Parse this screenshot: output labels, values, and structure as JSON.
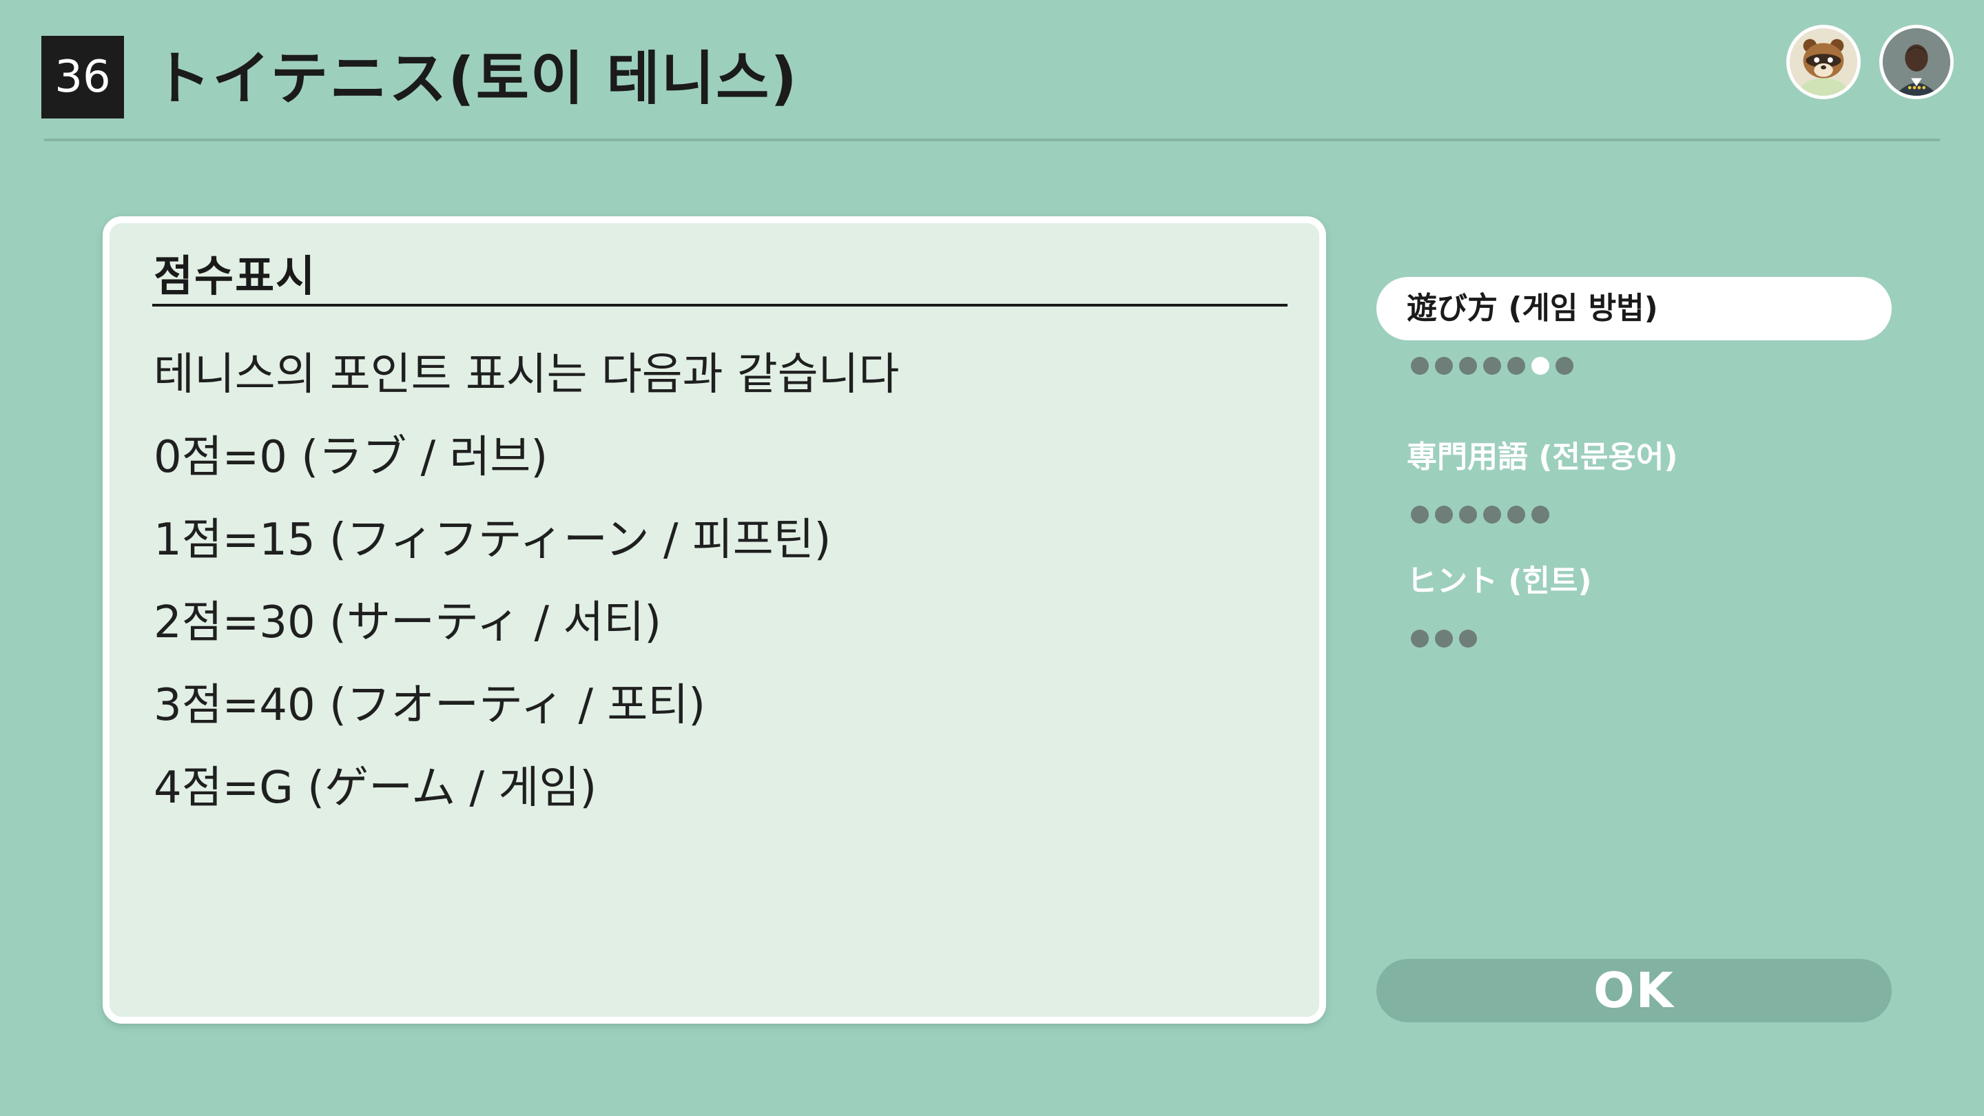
{
  "header": {
    "game_number": "36",
    "title": "トイテニス(토이 테니스)"
  },
  "panel": {
    "heading": "점수표시",
    "lines": [
      "테니스의 포인트 표시는 다음과 같습니다",
      "0점=0 (ラブ / 러브)",
      "1점=15 (フィフティーン / 피프틴)",
      "2점=30 (サーティ / 서티)",
      "3점=40 (フオーティ / 포티)",
      "4점=G (ゲーム / 게임)"
    ]
  },
  "menu": {
    "items": [
      {
        "label": "遊び方 (게임 방법)",
        "active": true,
        "page_count": 7,
        "current_page": 6
      },
      {
        "label": "専門用語 (전문용어)",
        "active": false,
        "page_count": 6
      },
      {
        "label": "ヒント (힌트)",
        "active": false,
        "page_count": 3
      }
    ]
  },
  "ok_button": {
    "label": "OK"
  },
  "icons": {
    "avatar_1": "raccoon-character-avatar-icon",
    "avatar_2": "player-avatar-icon"
  },
  "colors": {
    "background": "#9dcfbd",
    "panel": "#e1efe5",
    "ok_button": "#82b2a1",
    "dot": "#6e7e79"
  }
}
